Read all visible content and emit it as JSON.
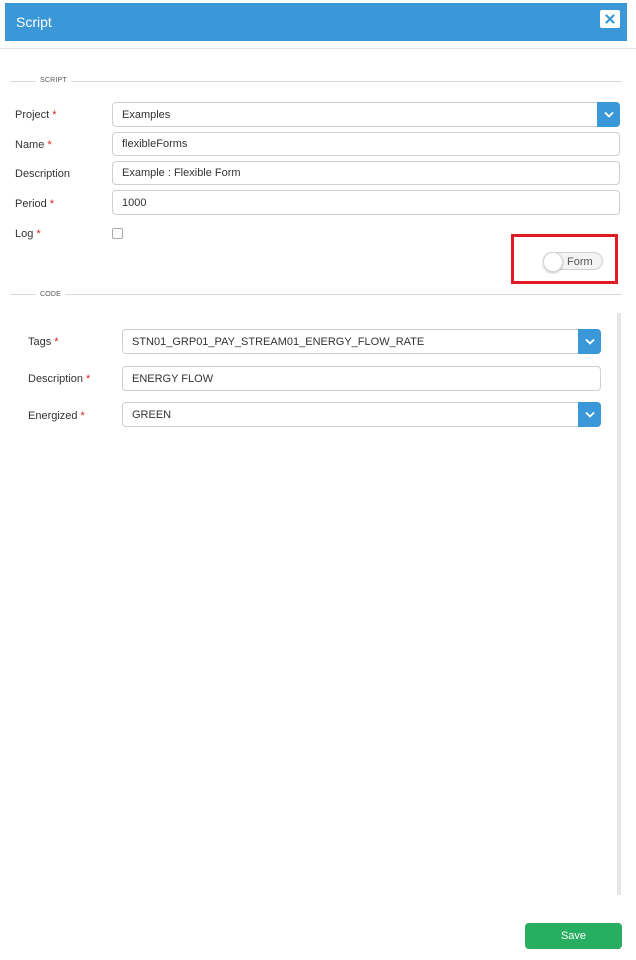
{
  "dialog": {
    "title": "Script",
    "close_icon": "close-icon"
  },
  "script_section": {
    "heading": "SCRIPT",
    "project": {
      "label": "Project",
      "required": "*",
      "value": "Examples"
    },
    "name": {
      "label": "Name",
      "required": "*",
      "value": "flexibleForms"
    },
    "description": {
      "label": "Description",
      "value": "Example : Flexible Form"
    },
    "period": {
      "label": "Period",
      "required": "*",
      "value": "1000"
    },
    "log": {
      "label": "Log",
      "required": "*",
      "checked": false
    },
    "form_toggle": {
      "label": "Form",
      "on": false
    }
  },
  "code_section": {
    "heading": "CODE",
    "tags": {
      "label": "Tags",
      "required": "*",
      "value": "STN01_GRP01_PAY_STREAM01_ENERGY_FLOW_RATE"
    },
    "description": {
      "label": "Description",
      "required": "*",
      "value": "ENERGY FLOW"
    },
    "energized": {
      "label": "Energized",
      "required": "*",
      "value": "GREEN"
    }
  },
  "footer": {
    "save_label": "Save"
  },
  "colors": {
    "header": "#3a98d8",
    "save": "#27ae60",
    "required": "#e02020",
    "highlight": "#e01b24"
  }
}
